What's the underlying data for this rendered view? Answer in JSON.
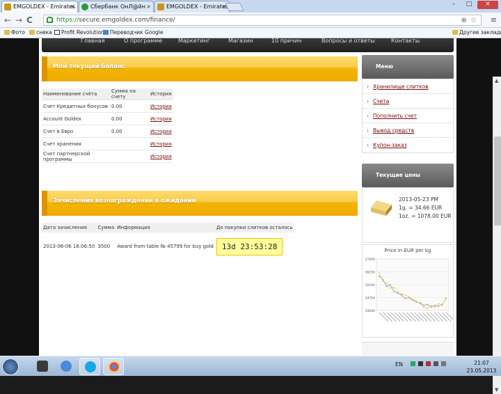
{
  "browser": {
    "tabs": [
      {
        "label": "EMGOLDEX - Emirates Go",
        "close": "×",
        "favicon_color": "#c8961e"
      },
      {
        "label": "Сбербанк ОнЛ@йн",
        "close": "×",
        "favicon_color": "#2a9a3a"
      },
      {
        "label": "EMGOLDEX - Emirates Go",
        "close": "×",
        "favicon_color": "#c8961e"
      }
    ],
    "window_buttons": {
      "minimize": "–",
      "maximize": "□",
      "close": "×"
    },
    "nav": {
      "back": "←",
      "forward": "→",
      "reload": "C",
      "home": "⌂"
    },
    "url_scheme": "https://",
    "url_rest": "secure.emgoldex.com/finance/",
    "zoom_icon": "zoom-icon",
    "star_icon": "star-icon",
    "wrench_icon": "wrench-icon",
    "bookmarks": [
      {
        "label": "Фото",
        "icon": "folder-icon"
      },
      {
        "label": "снека",
        "icon": "folder-icon"
      },
      {
        "label": "Profit Revolution",
        "icon": "p-icon"
      },
      {
        "label": "Переводчик Google",
        "icon": "translate-icon"
      }
    ],
    "other_bookmarks": "Другие закладки"
  },
  "site": {
    "topnav": [
      "Главная",
      "О программе",
      "Маркетинг",
      "Магазин",
      "10 причин",
      "Вопросы и ответы",
      "Контакты"
    ],
    "balance": {
      "title": "Мой текущий баланс",
      "headers": [
        "Наименование счёта",
        "Сумма на счету",
        "История"
      ],
      "rows": [
        {
          "name": "Счет Кредитных бонусов",
          "sum": "0.00",
          "hist": "История"
        },
        {
          "name": "Account Goldex",
          "sum": "0.00",
          "hist": "История"
        },
        {
          "name": "Счет в Евро",
          "sum": "0.00",
          "hist": "История"
        },
        {
          "name": "Счет хранения",
          "sum": "",
          "hist": "История"
        },
        {
          "name": "Счет партнерской программы",
          "sum": "",
          "hist": "История"
        }
      ]
    },
    "pending": {
      "title": "Зачисления вознаграждений в ожидании",
      "headers": [
        "Дата зачисления",
        "Сумма",
        "Информация",
        "До покупки слитков осталось"
      ],
      "rows": [
        {
          "date": "2013-06-06 16:06:50",
          "sum": "3500",
          "info": "Award from table № 45799 for buy gold",
          "timer": "13d 23:53:28"
        }
      ]
    },
    "sidebar": {
      "menu_title": "Меню",
      "menu_items": [
        "Хранилище слитков",
        "Счета",
        "Пополнить счет",
        "Вывод средств",
        "Купон-заказ"
      ],
      "prices_title": "Текущие цены",
      "price_date": "2013-05-23 PM",
      "price_g": "1g.    =   34.66 EUR",
      "price_oz": "1oz.  =  1078.00 EUR",
      "chart_title": "Price in EUR per kg"
    }
  },
  "chart_data": {
    "type": "line",
    "title": "Price in EUR per kg",
    "y_ticks": [
      "37000",
      "36250",
      "35500",
      "34750",
      "34000"
    ],
    "ylim": [
      34000,
      37000
    ],
    "series": [
      {
        "color": "#9090c8",
        "values": [
          36000,
          35800,
          35400,
          35500,
          35100,
          35000,
          34900,
          34700,
          34750,
          34600,
          34500,
          34450,
          34300,
          34350,
          34200,
          34300,
          34250,
          34350,
          34700
        ]
      },
      {
        "color": "#e8d24a",
        "values": [
          36200,
          35700,
          35600,
          35300,
          35350,
          35100,
          34950,
          34900,
          34800,
          34650,
          34550,
          34400,
          34200,
          34100,
          34300,
          34200,
          34400,
          34300,
          34750
        ]
      }
    ]
  },
  "taskbar": {
    "lang": "EN",
    "time": "21:07",
    "date": "23.05.2013"
  }
}
